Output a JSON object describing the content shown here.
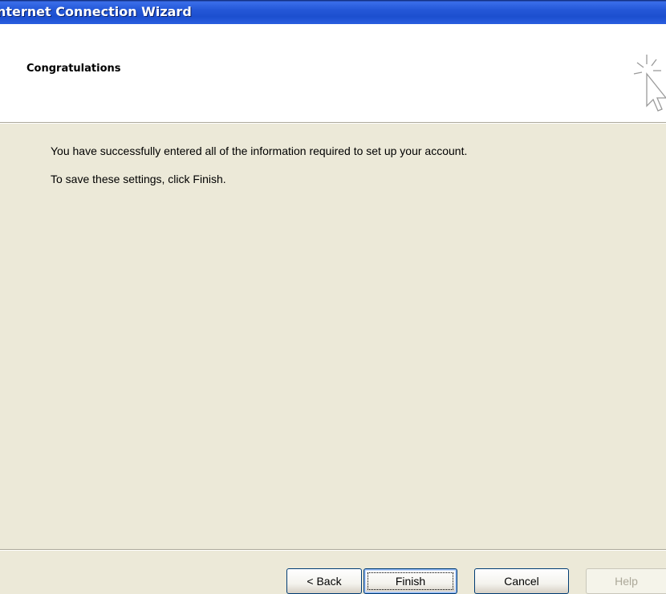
{
  "window": {
    "title": "nternet Connection Wizard"
  },
  "header": {
    "title": "Congratulations",
    "icon": "wizard-sparkle-cursor-icon"
  },
  "body": {
    "line1": "You have successfully entered all of the information required to set up your account.",
    "line2": "To save these settings, click Finish."
  },
  "buttons": {
    "back": "< Back",
    "finish": "Finish",
    "cancel": "Cancel",
    "help": "Help"
  },
  "colors": {
    "titlebar": "#2458D8",
    "dialog_bg": "#ECE9D8",
    "header_bg": "#FFFFFF",
    "disabled_text": "#ACA899"
  }
}
